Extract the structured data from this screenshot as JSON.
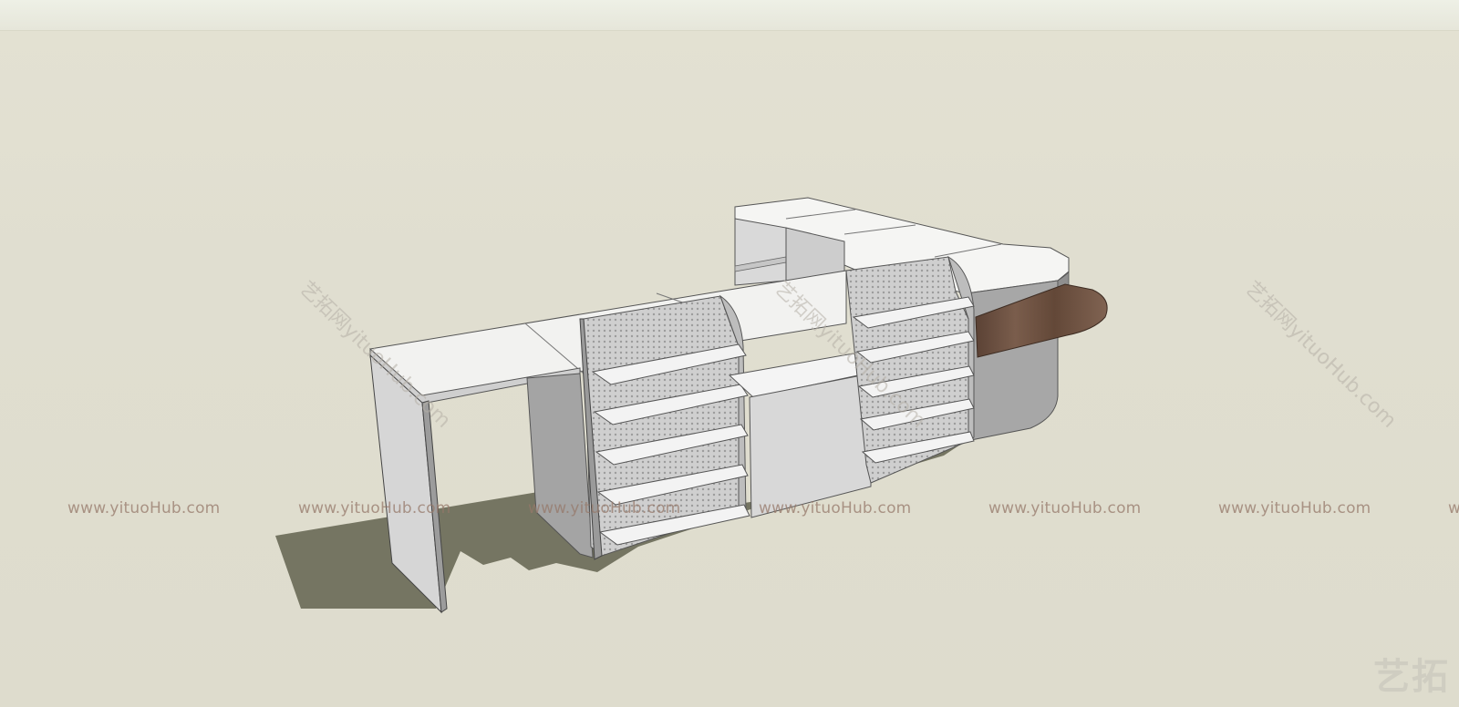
{
  "watermark": {
    "url_text": "www.yituoHub.com",
    "diagonal_text": "艺拓网yituoHub.com",
    "logo_text": "艺拓"
  },
  "scene": {
    "subject": "reception-counter-3d-model",
    "colors": {
      "background": "#e0ded0",
      "panel_white": "#f4f4f2",
      "panel_shade": "#c9c9c9",
      "panel_dark": "#a9a9a9",
      "shadow": "#747461",
      "wood": "#6f5444"
    }
  }
}
